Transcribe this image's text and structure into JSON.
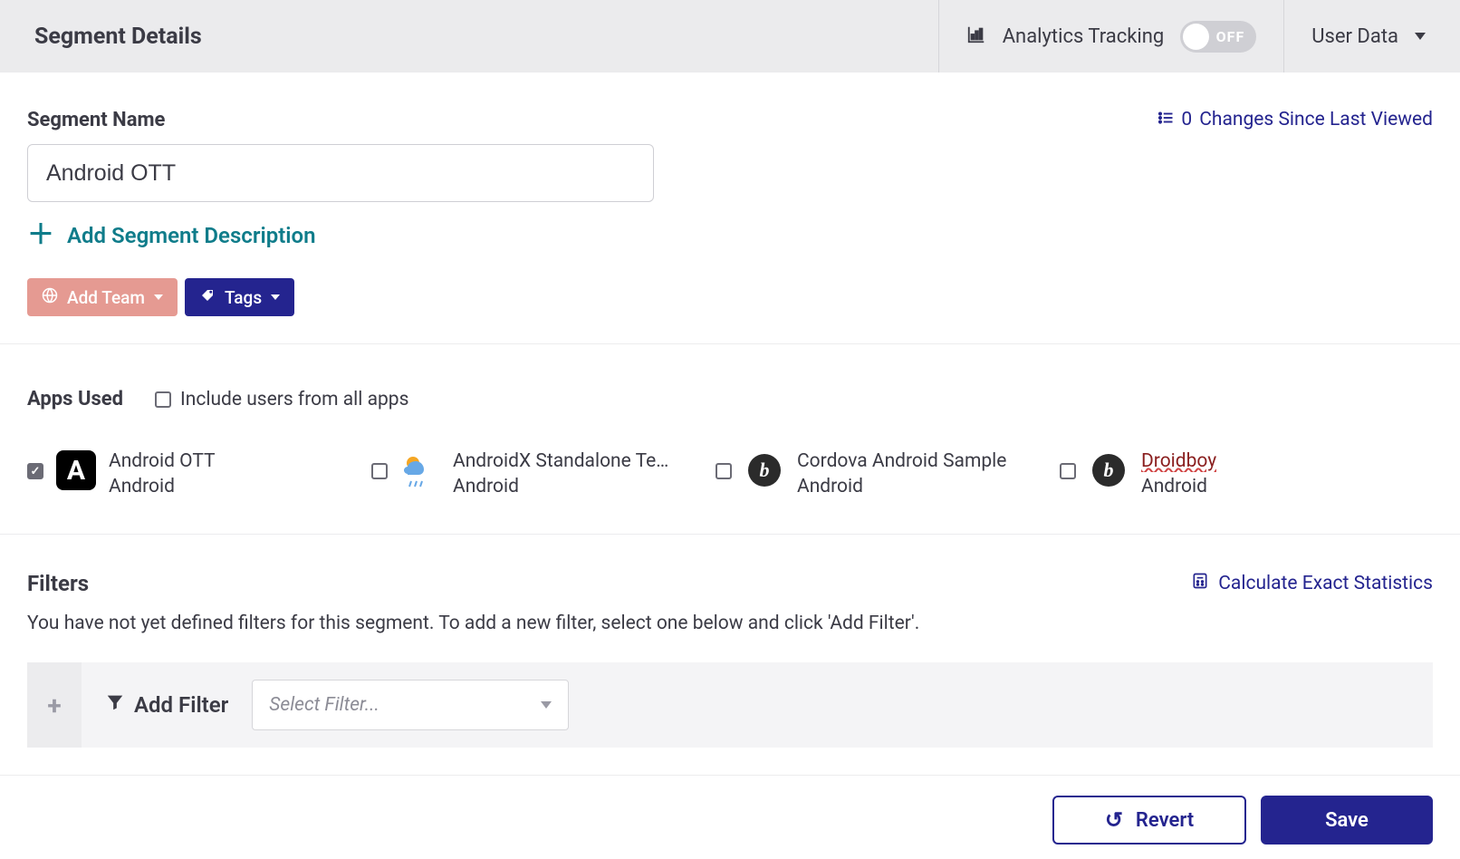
{
  "topbar": {
    "title": "Segment Details",
    "analytics_label": "Analytics Tracking",
    "toggle_text": "OFF",
    "user_data_label": "User Data"
  },
  "segment": {
    "name_label": "Segment Name",
    "name_value": "Android OTT",
    "changes_count": "0",
    "changes_text": "Changes Since Last Viewed",
    "add_description_label": "Add Segment Description",
    "add_team_label": "Add Team",
    "tags_label": "Tags"
  },
  "apps": {
    "title": "Apps Used",
    "include_all_label": "Include users from all apps",
    "items": [
      {
        "name": "Android OTT",
        "platform": "Android",
        "checked": true,
        "icon": "a-black"
      },
      {
        "name": "AndroidX Standalone Te…",
        "platform": "Android",
        "checked": false,
        "icon": "weather"
      },
      {
        "name": "Cordova Android Sample",
        "platform": "Android",
        "checked": false,
        "icon": "circle-b"
      },
      {
        "name": "Droidboy",
        "platform": "Android",
        "checked": false,
        "icon": "circle-b",
        "underline": true
      }
    ]
  },
  "filters": {
    "title": "Filters",
    "calc_label": "Calculate Exact Statistics",
    "description": "You have not yet defined filters for this segment. To add a new filter, select one below and click 'Add Filter'.",
    "add_filter_label": "Add Filter",
    "select_placeholder": "Select Filter..."
  },
  "footer": {
    "revert_label": "Revert",
    "save_label": "Save"
  }
}
